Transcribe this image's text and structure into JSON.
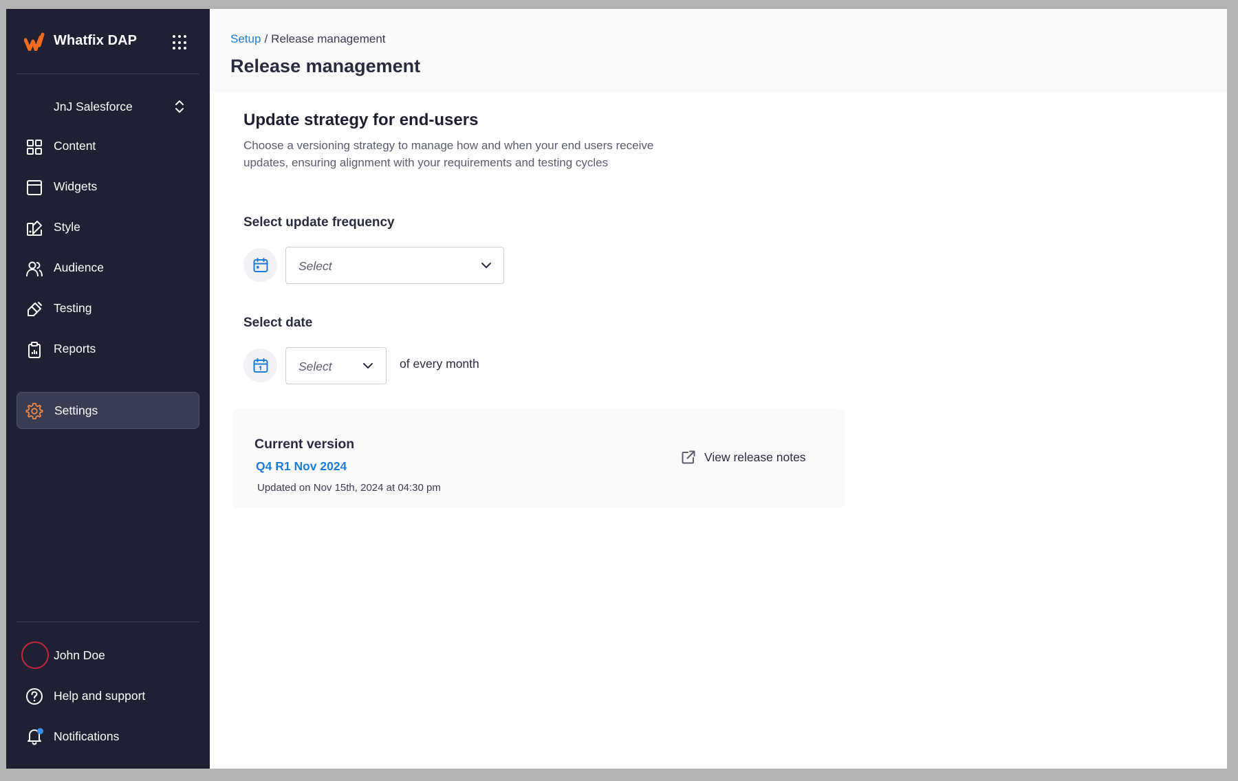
{
  "brand": {
    "name": "Whatfix DAP"
  },
  "account": {
    "name": "JnJ Salesforce"
  },
  "sidebar": {
    "items": [
      {
        "label": "Content",
        "icon": "grid-icon"
      },
      {
        "label": "Widgets",
        "icon": "widget-icon"
      },
      {
        "label": "Style",
        "icon": "palette-icon"
      },
      {
        "label": "Audience",
        "icon": "users-icon"
      },
      {
        "label": "Testing",
        "icon": "brush-icon"
      },
      {
        "label": "Reports",
        "icon": "clipboard-icon"
      },
      {
        "label": "Settings",
        "icon": "gear-icon",
        "active": true
      }
    ],
    "user": {
      "name": "John Doe"
    },
    "help": {
      "label": "Help and support"
    },
    "notifications": {
      "label": "Notifications"
    }
  },
  "breadcrumb": {
    "parent": "Setup",
    "separator": "/",
    "current": "Release management"
  },
  "page": {
    "title": "Release management"
  },
  "strategy": {
    "title": "Update strategy for end-users",
    "description_line1": "Choose a versioning strategy to manage how and when your end users receive",
    "description_line2": "updates, ensuring alignment with your requirements and testing cycles"
  },
  "frequency": {
    "label": "Select update frequency",
    "value": "Select"
  },
  "date": {
    "label": "Select date",
    "value": "Select",
    "suffix": "of every month"
  },
  "version": {
    "title": "Current version",
    "name": "Q4 R1 Nov 2024",
    "updated": "Updated on Nov 15th, 2024 at 04:30 pm",
    "release_notes_label": "View release notes"
  },
  "colors": {
    "sidebar_bg": "#1f2133",
    "accent_blue": "#1f7bd3",
    "brand_orange": "#f26b21",
    "settings_icon": "#f0864a",
    "avatar_ring": "#c0263e"
  }
}
